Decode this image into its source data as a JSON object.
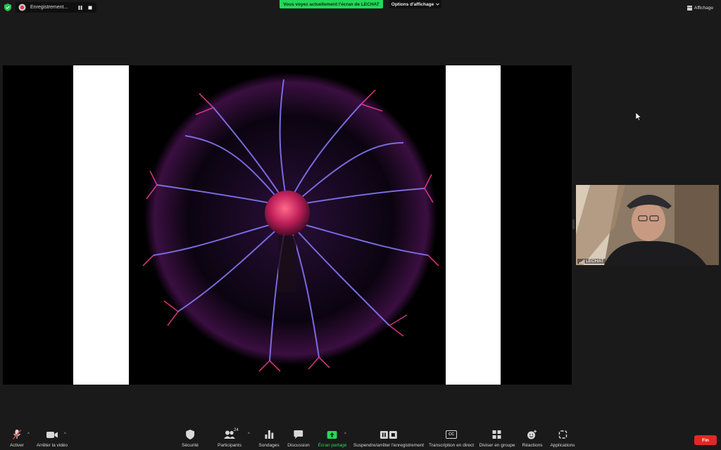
{
  "topbar": {
    "recording_label": "Enregistrement...",
    "share_banner": "Vous voyez actuellement l'écran de LECHAT",
    "view_options": "Options d'affichage",
    "view_button": "Affichage"
  },
  "video": {
    "participant_name": "LECHAT"
  },
  "toolbar": {
    "unmute_label": "Activer",
    "stop_video_label": "Arrêter la vidéo",
    "security_label": "Sécurité",
    "participants_label": "Participants",
    "participants_count": "24",
    "polls_label": "Sondages",
    "chat_label": "Discussion",
    "share_label": "Écran partagé",
    "record_label": "Suspendre/arrêter l'enregistrement",
    "captions_label": "Transcription en direct",
    "captions_icon_text": "CC",
    "breakout_label": "Diviser en groupe",
    "reactions_label": "Réactions",
    "apps_label": "Applications",
    "end_label": "Fin"
  },
  "colors": {
    "share_green": "#23d959",
    "end_red": "#e02828",
    "background": "#1a1a1a"
  }
}
